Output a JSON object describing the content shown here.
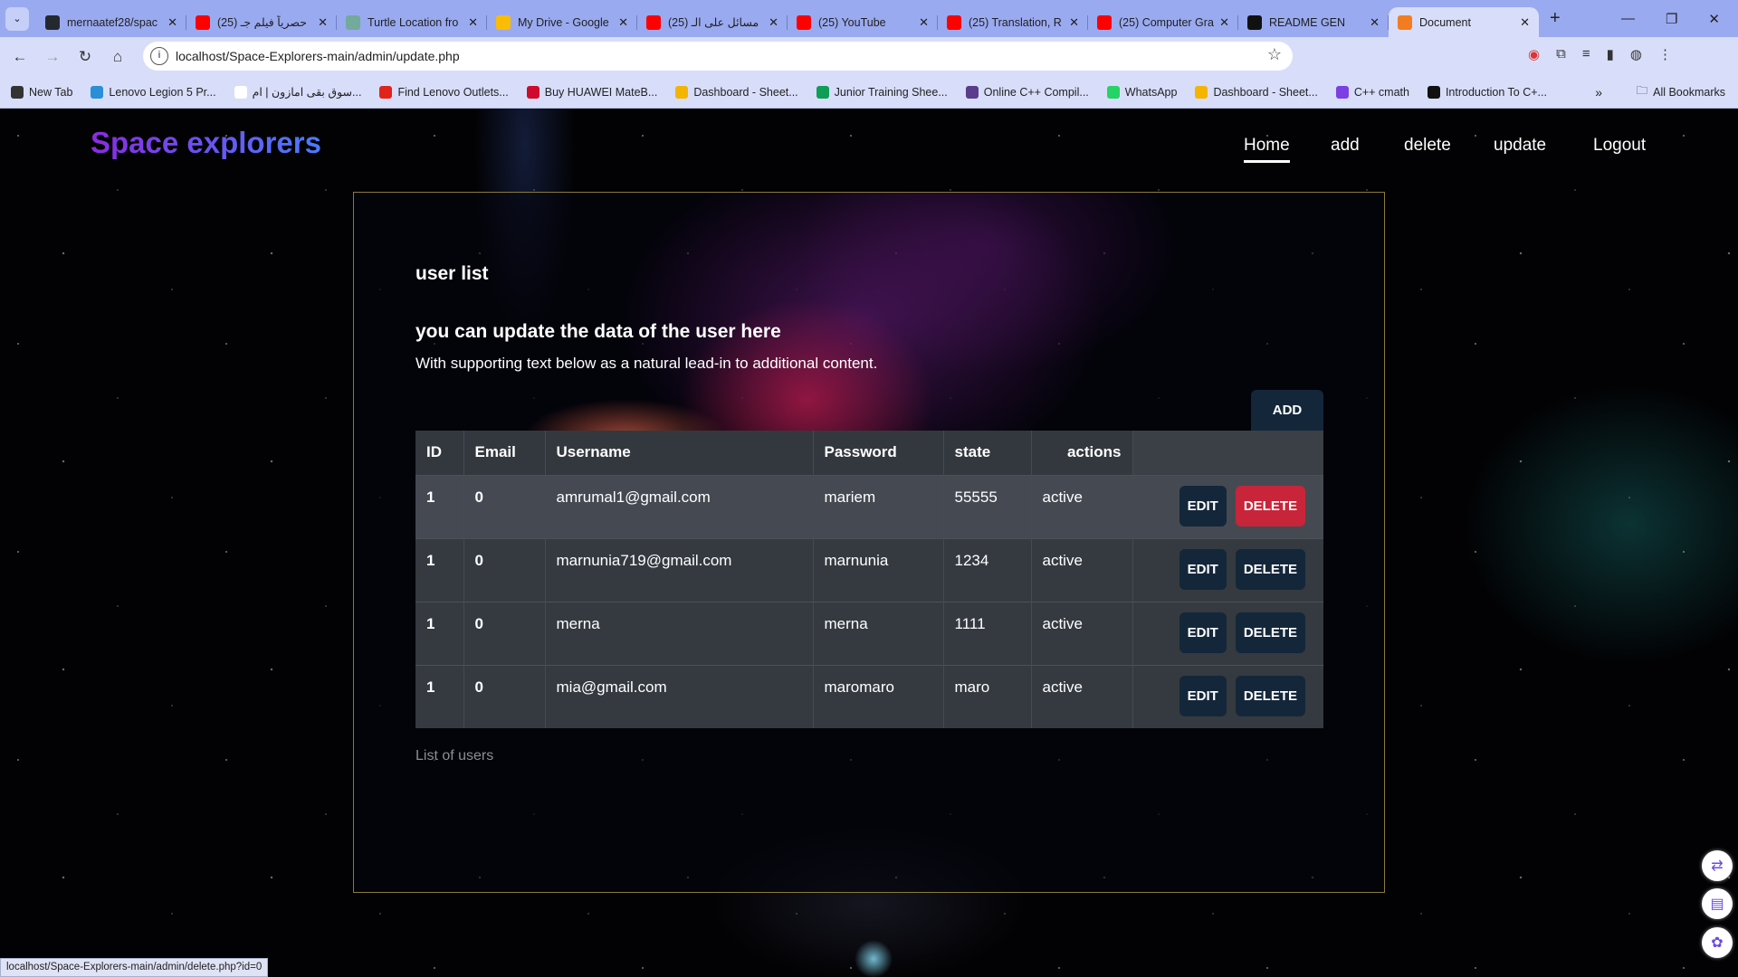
{
  "browser": {
    "tabs": [
      {
        "title": "mernaatef28/spac",
        "color": "#24292f",
        "active": false
      },
      {
        "title": "(25) حصرياً فيلم جـ",
        "color": "#ff0000",
        "active": false
      },
      {
        "title": "Turtle Location fro",
        "color": "#74aa9c",
        "active": false
      },
      {
        "title": "My Drive - Google",
        "color": "#fbbc04",
        "active": false
      },
      {
        "title": "(25) مسائل على الـ",
        "color": "#ff0000",
        "active": false
      },
      {
        "title": "(25) YouTube",
        "color": "#ff0000",
        "active": false
      },
      {
        "title": "(25) Translation, R",
        "color": "#ff0000",
        "active": false
      },
      {
        "title": "(25) Computer Gra",
        "color": "#ff0000",
        "active": false
      },
      {
        "title": "README GEN",
        "color": "#111111",
        "active": false
      },
      {
        "title": "Document",
        "color": "#f47c20",
        "active": true
      }
    ],
    "url": "localhost/Space-Explorers-main/admin/update.php",
    "bookmarks": [
      {
        "label": "New Tab",
        "color": "#333333"
      },
      {
        "label": "Lenovo Legion 5 Pr...",
        "color": "#2a8fd6"
      },
      {
        "label": "سوق بقى امازون | ام...",
        "color": "#ffffff"
      },
      {
        "label": "Find Lenovo Outlets...",
        "color": "#e2231a"
      },
      {
        "label": "Buy HUAWEI MateB...",
        "color": "#cf0a2c"
      },
      {
        "label": "Dashboard - Sheet...",
        "color": "#f4b400"
      },
      {
        "label": "Junior Training Shee...",
        "color": "#0f9d58"
      },
      {
        "label": "Online C++ Compil...",
        "color": "#5b3c8c"
      },
      {
        "label": "WhatsApp",
        "color": "#25d366"
      },
      {
        "label": "Dashboard - Sheet...",
        "color": "#f4b400"
      },
      {
        "label": "C++ cmath",
        "color": "#7b3fe4"
      },
      {
        "label": "Introduction To C+...",
        "color": "#111111"
      }
    ],
    "all_bookmarks": "All Bookmarks",
    "status_url": "localhost/Space-Explorers-main/admin/delete.php?id=0"
  },
  "site": {
    "logo": "Space explorers",
    "nav": [
      "Home",
      "add",
      "delete",
      "update",
      "Logout"
    ],
    "active_nav": "Home"
  },
  "card": {
    "title": "user list",
    "heading": "you can update the data of the user here",
    "text": "With supporting text below as a natural lead-in to additional content.",
    "add_label": "ADD",
    "caption": "List of users",
    "columns": [
      "ID",
      "Email",
      "Username",
      "Password",
      "state",
      "actions"
    ],
    "rows": [
      [
        "1",
        "0",
        "amrumal1@gmail.com",
        "mariem",
        "55555",
        "active"
      ],
      [
        "1",
        "0",
        "marnunia719@gmail.com",
        "marnunia",
        "1234",
        "active"
      ],
      [
        "1",
        "0",
        "merna",
        "merna",
        "1111",
        "active"
      ],
      [
        "1",
        "0",
        "mia@gmail.com",
        "maromaro",
        "maro",
        "active"
      ]
    ],
    "edit_label": "EDIT",
    "delete_label": "DELETE",
    "danger_color": "#c8243a"
  }
}
